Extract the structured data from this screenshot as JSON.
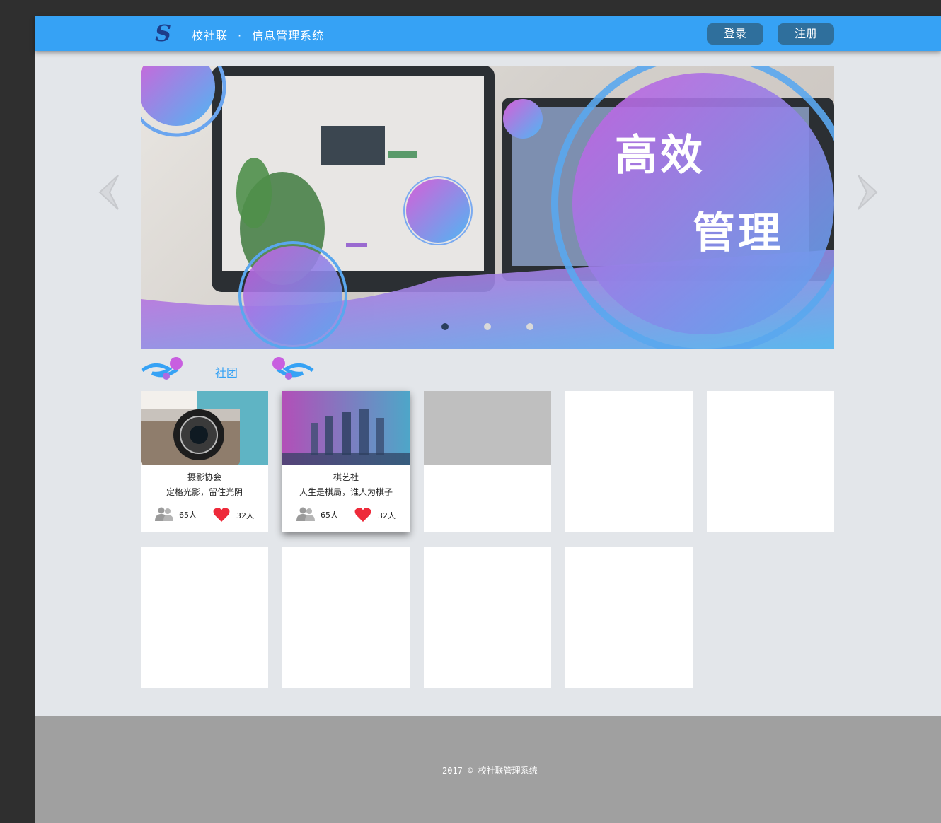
{
  "header": {
    "logo_glyph": "S",
    "brand_name": "校社联",
    "brand_sep": "·",
    "brand_subtitle": "信息管理系统",
    "login_label": "登录",
    "register_label": "注册"
  },
  "banner": {
    "text_line1": "高效",
    "text_line2": "管理",
    "dots_count": 3,
    "active_dot": 0
  },
  "section": {
    "title": "社团"
  },
  "cards": [
    {
      "name": "摄影协会",
      "desc": "定格光影，留住光阴",
      "members": "65人",
      "likes": "32人",
      "thumb": "camera"
    },
    {
      "name": "棋艺社",
      "desc": "人生是棋局，谁人为棋子",
      "members": "65人",
      "likes": "32人",
      "thumb": "chess"
    }
  ],
  "footer": {
    "copyright": "2017 © 校社联管理系统"
  },
  "colors": {
    "header_bg": "#36a2f5",
    "button_bg": "#2f6f9c",
    "page_bg": "#e3e6ea",
    "footer_bg": "#a0a0a0",
    "accent": "#36a2f5"
  }
}
